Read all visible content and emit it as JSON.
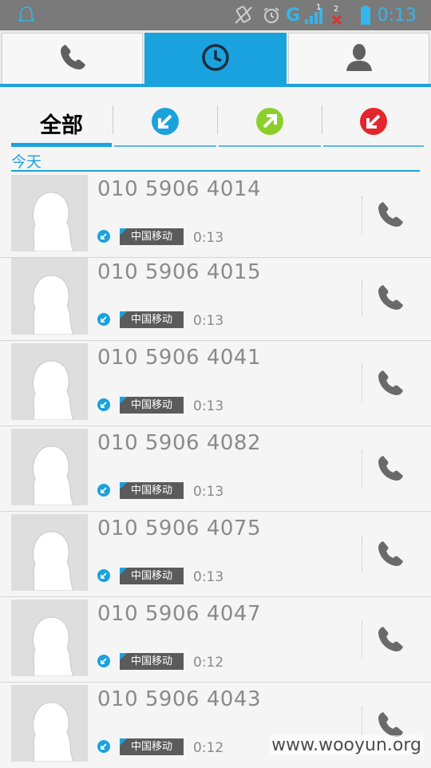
{
  "status_bar": {
    "time": "0:13",
    "network": "G",
    "sim1_label": "1",
    "sim2_label": "2",
    "colors": {
      "background": "#7a7a7a",
      "icons": "#35b6ea",
      "sim2_x": "#e03030"
    }
  },
  "top_tabs": [
    {
      "icon": "phone-icon",
      "active": false
    },
    {
      "icon": "clock-icon",
      "active": true
    },
    {
      "icon": "contact-icon",
      "active": false
    }
  ],
  "filters": [
    {
      "label": "全部",
      "active": true
    },
    {
      "icon": "incoming-call-icon",
      "color": "#1aa2de"
    },
    {
      "icon": "outgoing-call-icon",
      "color": "#8ccf2b"
    },
    {
      "icon": "missed-call-icon",
      "color": "#e3262b"
    }
  ],
  "section_header": "今天",
  "calls": [
    {
      "number": "010 5906 4014",
      "carrier": "中国移动",
      "duration": "0:13",
      "type": "incoming"
    },
    {
      "number": "010 5906 4015",
      "carrier": "中国移动",
      "duration": "0:13",
      "type": "incoming"
    },
    {
      "number": "010 5906 4041",
      "carrier": "中国移动",
      "duration": "0:13",
      "type": "incoming"
    },
    {
      "number": "010 5906 4082",
      "carrier": "中国移动",
      "duration": "0:13",
      "type": "incoming"
    },
    {
      "number": "010 5906 4075",
      "carrier": "中国移动",
      "duration": "0:13",
      "type": "incoming"
    },
    {
      "number": "010 5906 4047",
      "carrier": "中国移动",
      "duration": "0:12",
      "type": "incoming"
    },
    {
      "number": "010 5906 4043",
      "carrier": "中国移动",
      "duration": "0:12",
      "type": "incoming"
    }
  ],
  "watermark": "www.wooyun.org",
  "colors": {
    "accent": "#1aa2de",
    "carrier_badge": "#5b5b5b",
    "text_gray": "#8a8a8a"
  }
}
